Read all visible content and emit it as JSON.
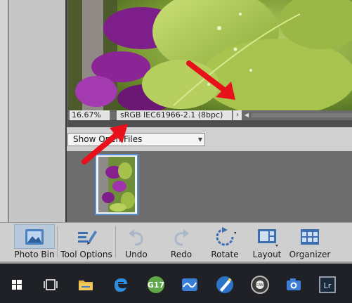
{
  "status_bar": {
    "zoom": "16.67%",
    "color_profile": "sRGB IEC61966-2.1 (8bpc)",
    "more_glyph": "›",
    "scroll_left_glyph": "◀"
  },
  "bin": {
    "dropdown_value": "Show Open Files"
  },
  "toolbar": {
    "photo_bin_label": "Photo Bin",
    "tool_options_label": "Tool Options",
    "undo_label": "Undo",
    "redo_label": "Redo",
    "rotate_label": "Rotate",
    "layout_label": "Layout",
    "organizer_label": "Organizer"
  },
  "taskbar": {
    "items": [
      {
        "name": "windows-start",
        "icon": "windows-logo-icon"
      },
      {
        "name": "task-view",
        "icon": "task-view-icon"
      },
      {
        "name": "file-explorer",
        "icon": "folder-icon"
      },
      {
        "name": "edge",
        "icon": "edge-icon"
      },
      {
        "name": "g17",
        "icon": "g17-icon",
        "text": "G17"
      },
      {
        "name": "app-wave",
        "icon": "wave-icon"
      },
      {
        "name": "app-pen",
        "icon": "pen-icon"
      },
      {
        "name": "app-cam",
        "icon": "cam-icon",
        "text": "CAM"
      },
      {
        "name": "camera",
        "icon": "camera-icon"
      },
      {
        "name": "lightroom",
        "icon": "lightroom-icon",
        "text": "Lr"
      }
    ]
  },
  "colors": {
    "annotation_arrow": "#e8101a",
    "selection_accent": "#5b8fd3",
    "taskbar_bg": "#1f2126"
  }
}
